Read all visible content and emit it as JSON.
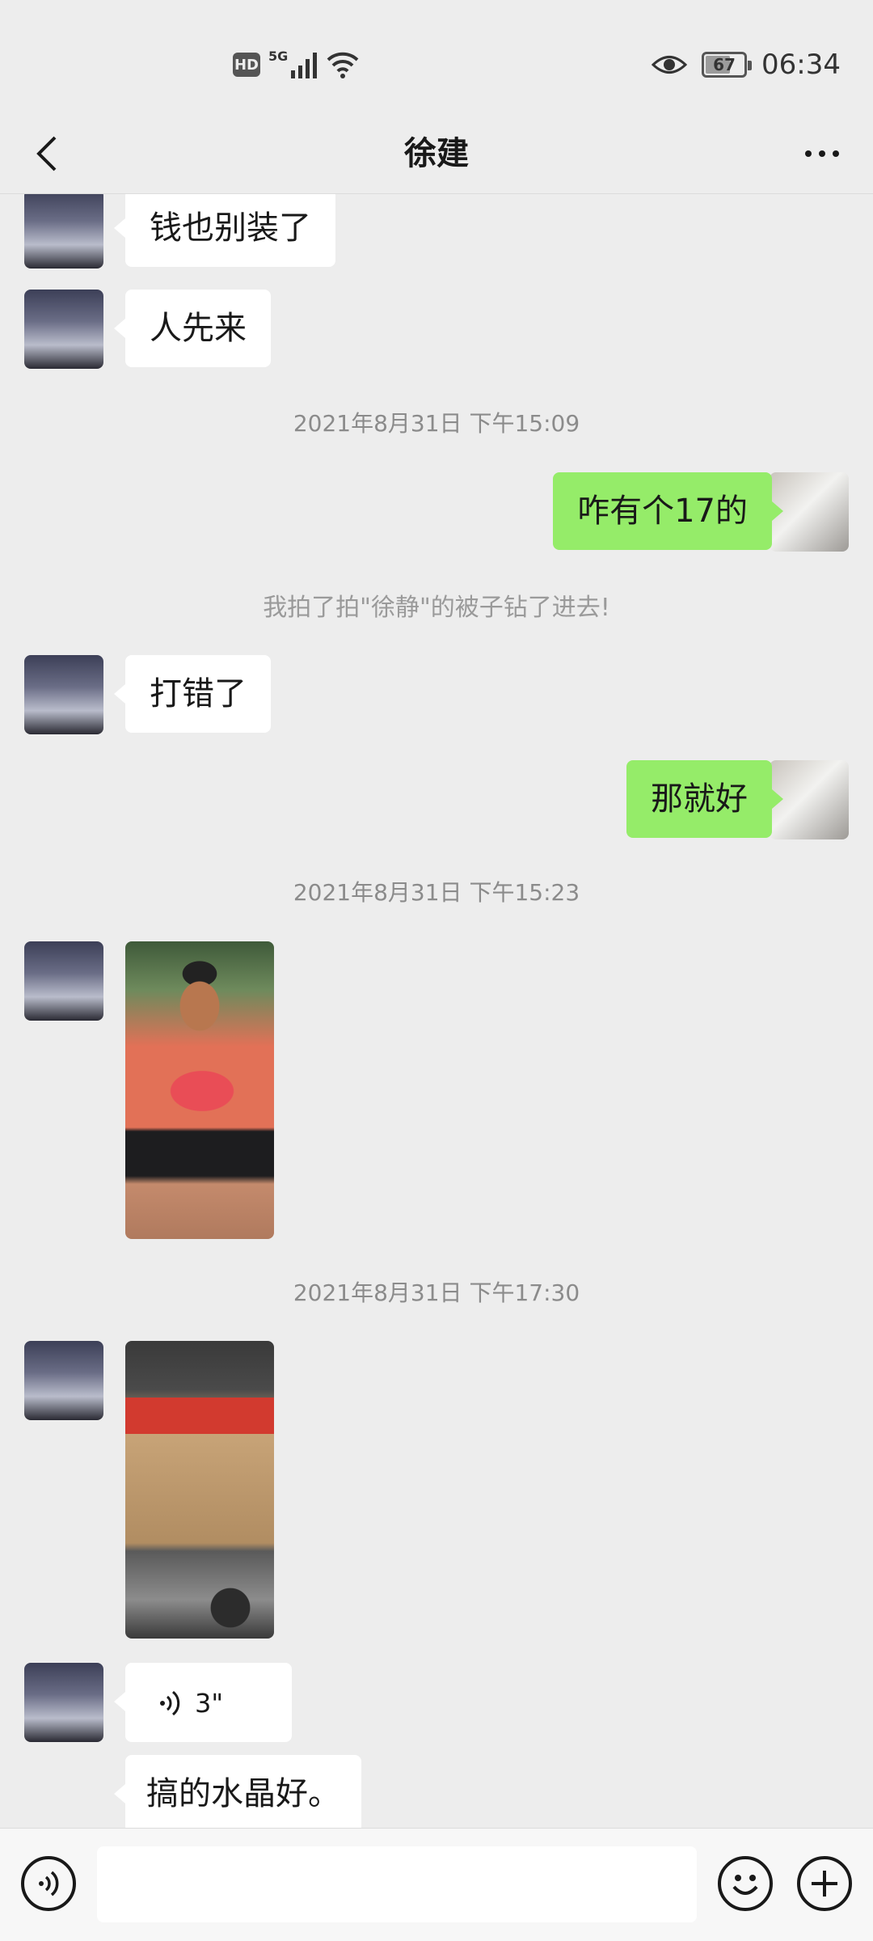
{
  "status_bar": {
    "hd": "HD",
    "network": "5G",
    "battery": "67",
    "time": "06:34"
  },
  "header": {
    "title": "徐建"
  },
  "messages": [
    {
      "type": "text",
      "side": "left",
      "text": "钱也别装了"
    },
    {
      "type": "text",
      "side": "left",
      "text": "人先来"
    },
    {
      "type": "timestamp",
      "text": "2021年8月31日 下午15:09"
    },
    {
      "type": "text",
      "side": "right",
      "text": "咋有个17的"
    },
    {
      "type": "system",
      "text": "我拍了拍\"徐静\"的被子钻了进去!"
    },
    {
      "type": "text",
      "side": "left",
      "text": "打错了"
    },
    {
      "type": "text",
      "side": "right",
      "text": "那就好"
    },
    {
      "type": "timestamp",
      "text": "2021年8月31日 下午15:23"
    },
    {
      "type": "image",
      "side": "left"
    },
    {
      "type": "timestamp",
      "text": "2021年8月31日 下午17:30"
    },
    {
      "type": "image",
      "side": "left"
    },
    {
      "type": "voice",
      "side": "left",
      "duration": "3\""
    },
    {
      "type": "text",
      "side": "left",
      "text": "搞的水晶好。"
    }
  ],
  "input_bar": {
    "placeholder": ""
  },
  "colors": {
    "background": "#ededed",
    "bubble_self": "#95ec69",
    "bubble_other": "#ffffff"
  }
}
